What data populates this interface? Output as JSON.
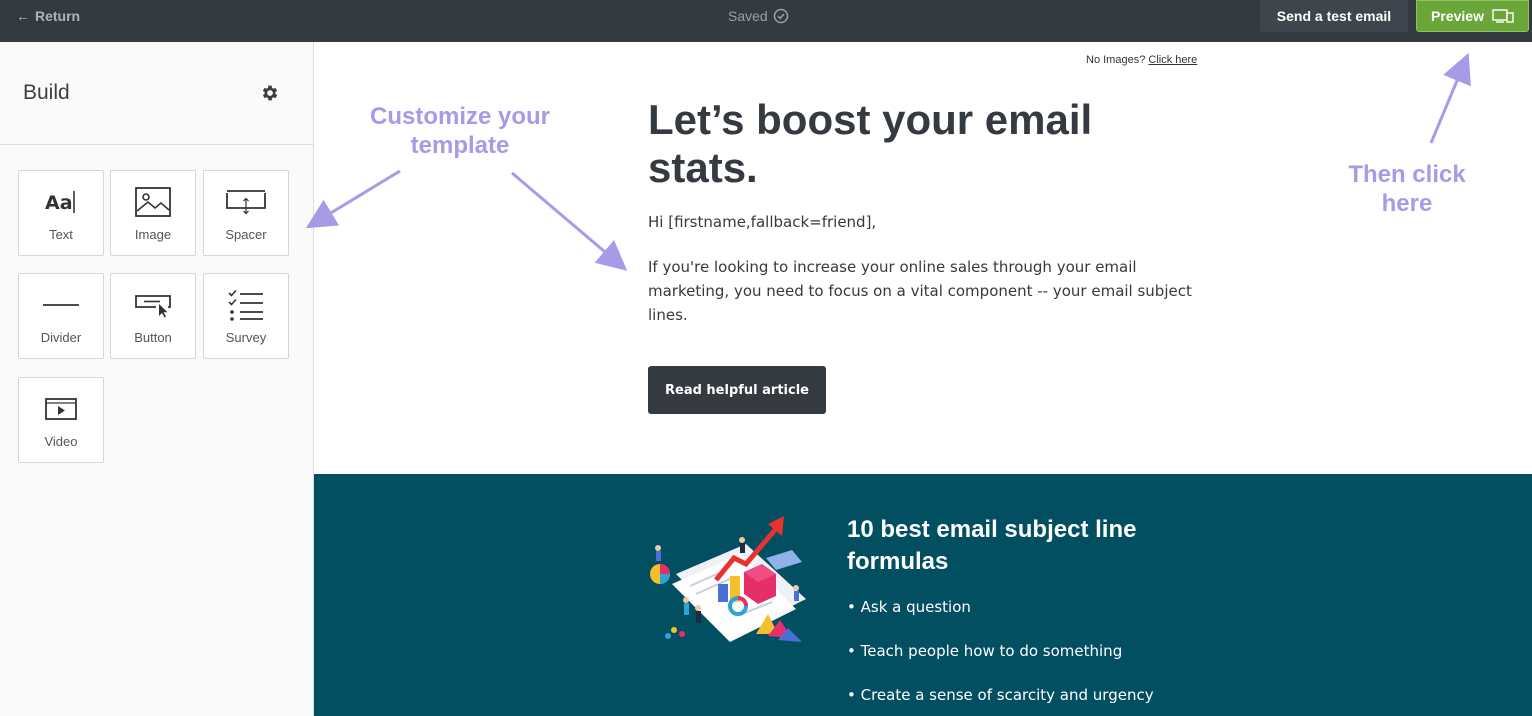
{
  "topbar": {
    "return_label": "Return",
    "saved_label": "Saved",
    "test_email_label": "Send a test email",
    "preview_label": "Preview"
  },
  "sidebar": {
    "title": "Build",
    "blocks": [
      {
        "label": "Text",
        "icon": "text-icon"
      },
      {
        "label": "Image",
        "icon": "image-icon"
      },
      {
        "label": "Spacer",
        "icon": "spacer-icon"
      },
      {
        "label": "Divider",
        "icon": "divider-icon"
      },
      {
        "label": "Button",
        "icon": "button-icon"
      },
      {
        "label": "Survey",
        "icon": "survey-icon"
      },
      {
        "label": "Video",
        "icon": "video-icon"
      }
    ]
  },
  "email": {
    "no_images_text": "No Images?",
    "no_images_link": "Click here",
    "headline": "Let’s boost your email stats.",
    "greeting": "Hi [firstname,fallback=friend],",
    "paragraph": "If you're looking to increase your online sales through your email marketing, you need to focus on a vital component -- your email subject lines.",
    "cta_label": "Read helpful article",
    "section_title": "10 best email subject line formulas",
    "bullets": [
      "• Ask a question",
      "• Teach people how to do something",
      "• Create a sense of scarcity and urgency"
    ]
  },
  "annotations": {
    "customize": "Customize your template",
    "then_click": "Then click here"
  },
  "colors": {
    "topbar": "#343a40",
    "preview_green": "#6aa63a",
    "teal_section": "#024f62",
    "annotation_purple": "#a99ae8"
  }
}
